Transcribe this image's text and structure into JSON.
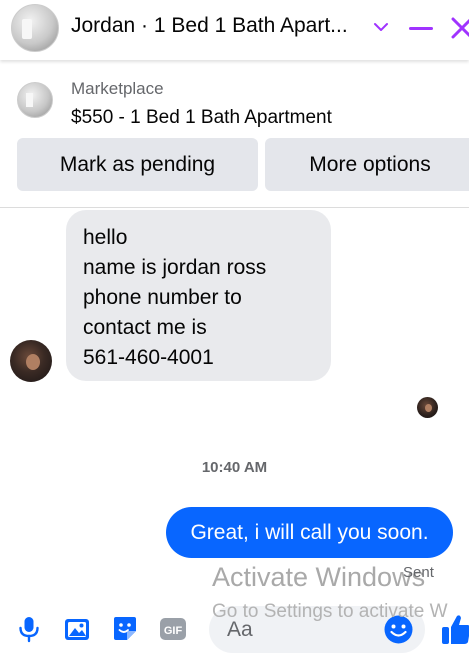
{
  "header": {
    "title": "Jordan · 1 Bed 1 Bath Apart...",
    "icons": [
      "chevron-down-icon",
      "minimize-icon",
      "close-icon"
    ],
    "accent_color": "#a033ff"
  },
  "marketplace": {
    "label": "Marketplace",
    "listing": "$550 - 1 Bed 1 Bath Apartment",
    "buttons": {
      "pending": "Mark as pending",
      "more": "More options"
    }
  },
  "messages": {
    "incoming": {
      "lines": [
        "hello",
        "name is jordan ross",
        "phone number to",
        "contact me is",
        "561-460-4001"
      ]
    },
    "timestamp": "10:40 AM",
    "outgoing": {
      "text": "Great, i will call you soon.",
      "status": "Sent",
      "bubble_color": "#0866ff"
    }
  },
  "watermark": {
    "title": "Activate Windows",
    "subtitle": "Go to Settings to activate W"
  },
  "composer": {
    "placeholder": "Aa",
    "icons": [
      "microphone-icon",
      "photo-icon",
      "sticker-icon",
      "gif-icon",
      "emoji-icon",
      "thumbs-up-icon"
    ],
    "icon_color": "#0866ff"
  }
}
